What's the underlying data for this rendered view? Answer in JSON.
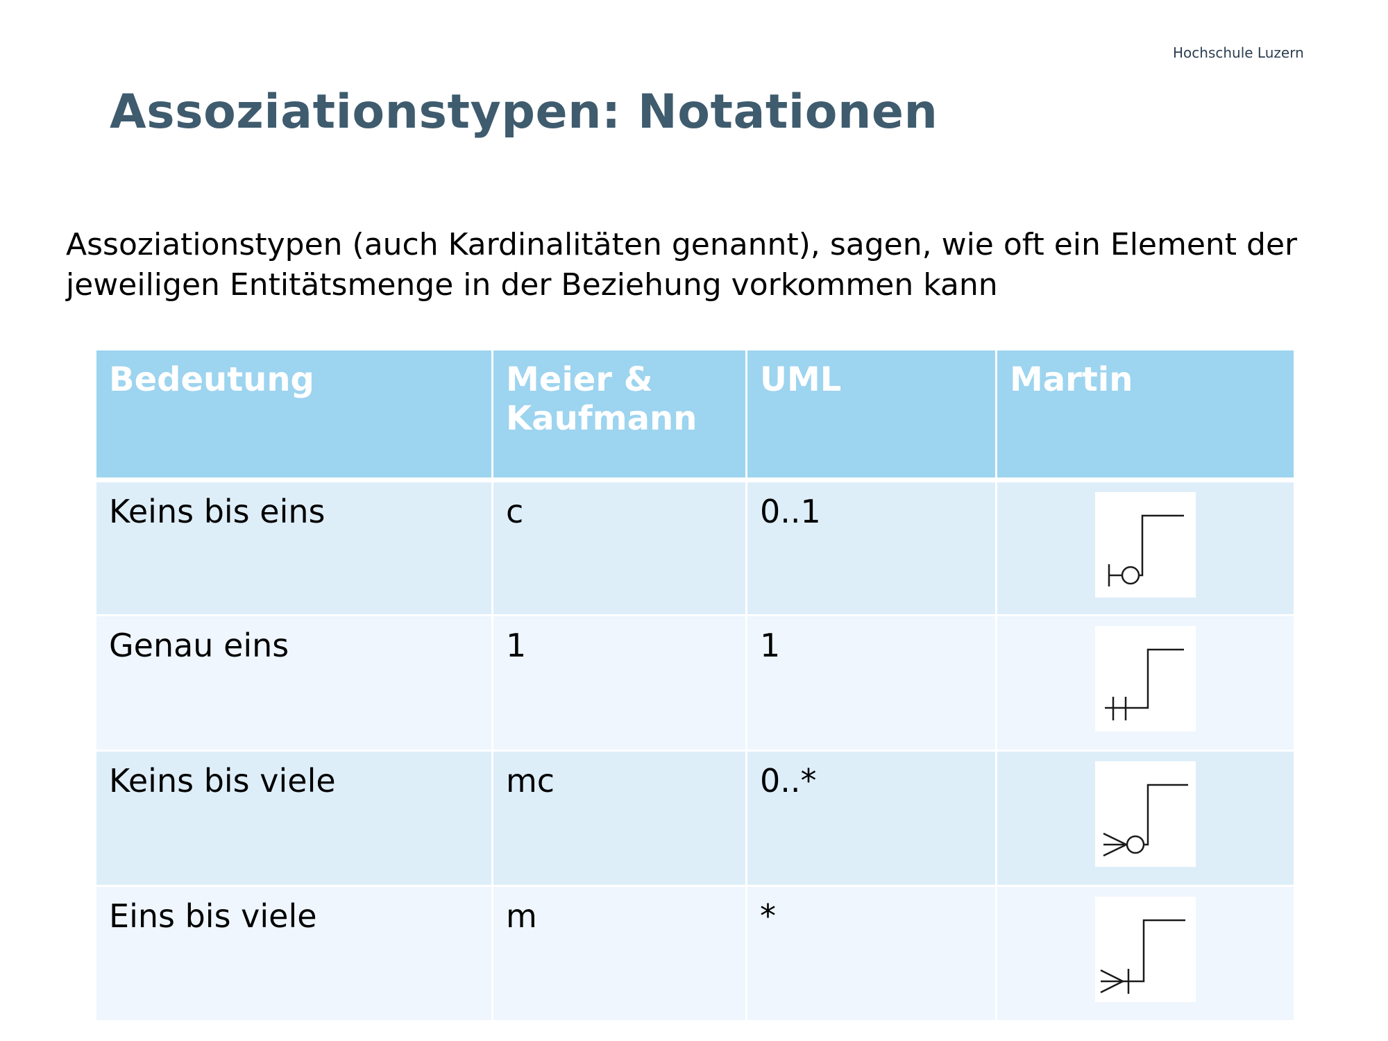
{
  "header": {
    "brand": "Hochschule Luzern",
    "title": "Assoziationstypen: Notationen"
  },
  "intro": {
    "text": "Assoziationstypen (auch Kardinalitäten genannt), sagen, wie oft ein Element der jeweiligen Entitätsmenge in der Beziehung vorkommen kann"
  },
  "table": {
    "columns": [
      "Bedeutung",
      "Meier & Kaufmann",
      "UML",
      "Martin"
    ],
    "rows": [
      {
        "bedeutung": "Keins bis eins",
        "meier_kaufmann": "c",
        "uml": "0..1",
        "martin_icon": "martin-zero-or-one-icon"
      },
      {
        "bedeutung": "Genau eins",
        "meier_kaufmann": "1",
        "uml": "1",
        "martin_icon": "martin-exactly-one-icon"
      },
      {
        "bedeutung": "Keins bis viele",
        "meier_kaufmann": "mc",
        "uml": "0..*",
        "martin_icon": "martin-zero-or-many-icon"
      },
      {
        "bedeutung": "Eins bis viele",
        "meier_kaufmann": "m",
        "uml": "*",
        "martin_icon": "martin-one-or-many-icon"
      }
    ]
  },
  "colors": {
    "title": "#3f5b6e",
    "header_bg": "#9dd4ef",
    "row_odd_bg": "#deeef9",
    "row_even_bg": "#eff6fd"
  }
}
